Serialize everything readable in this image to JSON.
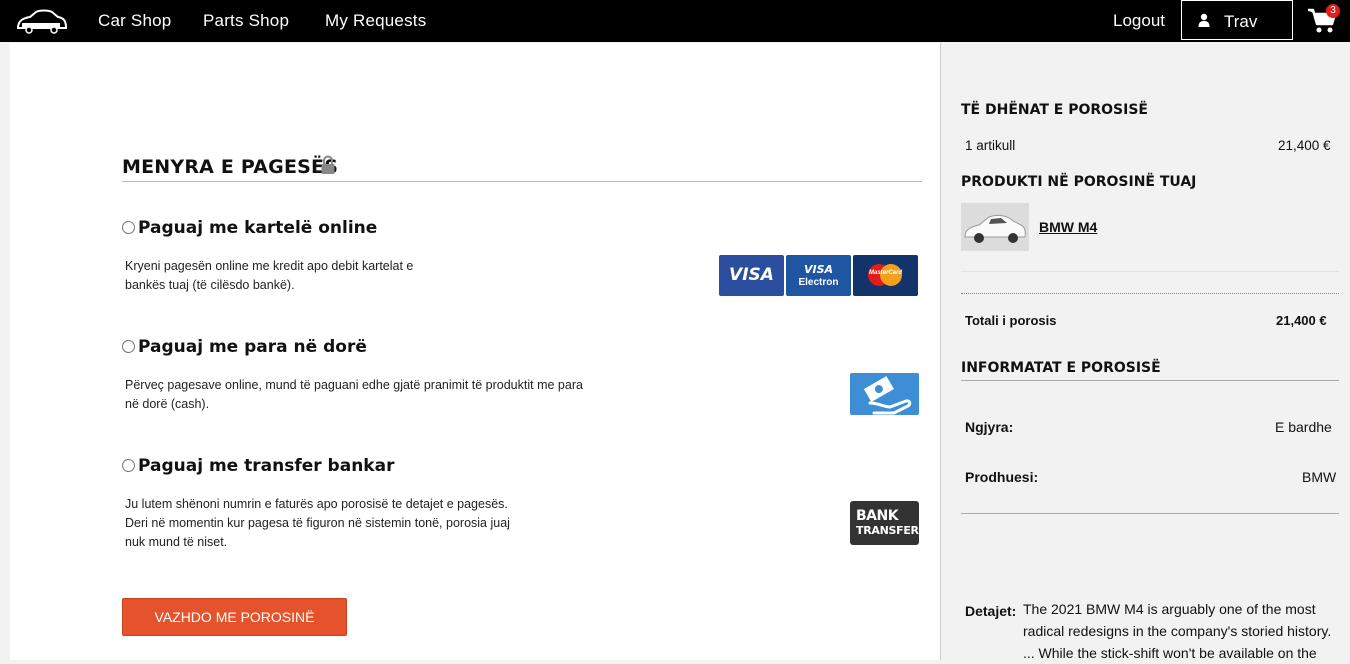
{
  "nav": {
    "links": [
      "Car Shop",
      "Parts Shop",
      "My Requests"
    ],
    "logout": "Logout",
    "user": "Trav",
    "cart_count": "3"
  },
  "payment": {
    "title": "MENYRA E PAGESËS",
    "options": [
      {
        "title": "Paguaj me kartelë online",
        "desc": [
          "Kryeni pagesën online me kredit apo debit kartelat e",
          "bankës tuaj (të cilësdo bankë)."
        ]
      },
      {
        "title": "Paguaj me para në dorë",
        "desc": [
          "Përveç pagesave online, mund të paguani edhe gjatë pranimit të produktit me para",
          "në dorë (cash)."
        ]
      },
      {
        "title": "Paguaj me transfer bankar",
        "desc": [
          "Ju lutem shënoni numrin e faturës apo porosisë te detajet e pagesës.",
          "Deri në momentin kur pagesa të figuron në sistemin tonë, porosia juaj",
          "nuk mund të niset."
        ]
      }
    ],
    "cards": {
      "visa": "VISA",
      "visa_electron_1": "VISA",
      "visa_electron_2": "Electron",
      "mastercard": "MasterCard"
    },
    "bank_icon": {
      "line1": "BANK",
      "line2": "TRANSFER"
    },
    "continue": "VAZHDO ME POROSINË"
  },
  "summary": {
    "order_title": "TË DHËNAT E POROSISË",
    "item_count": "1 artikull",
    "item_price": "21,400 €",
    "product_title": "PRODUKTI NË POROSINË TUAJ",
    "product_name": "BMW M4",
    "total_label": "Totali i porosis",
    "total_value": "21,400 €",
    "info_title": "INFORMATAT E POROSISË",
    "color_label": "Ngjyra:",
    "color_value": "E bardhe",
    "maker_label": "Prodhuesi:",
    "maker_value": "BMW",
    "details_label": "Detajet:",
    "details_lines": [
      "The 2021 BMW M4 is arguably one of the most",
      "radical redesigns in the company's storied history.",
      "... While the stick-shift won't be available on the"
    ]
  }
}
